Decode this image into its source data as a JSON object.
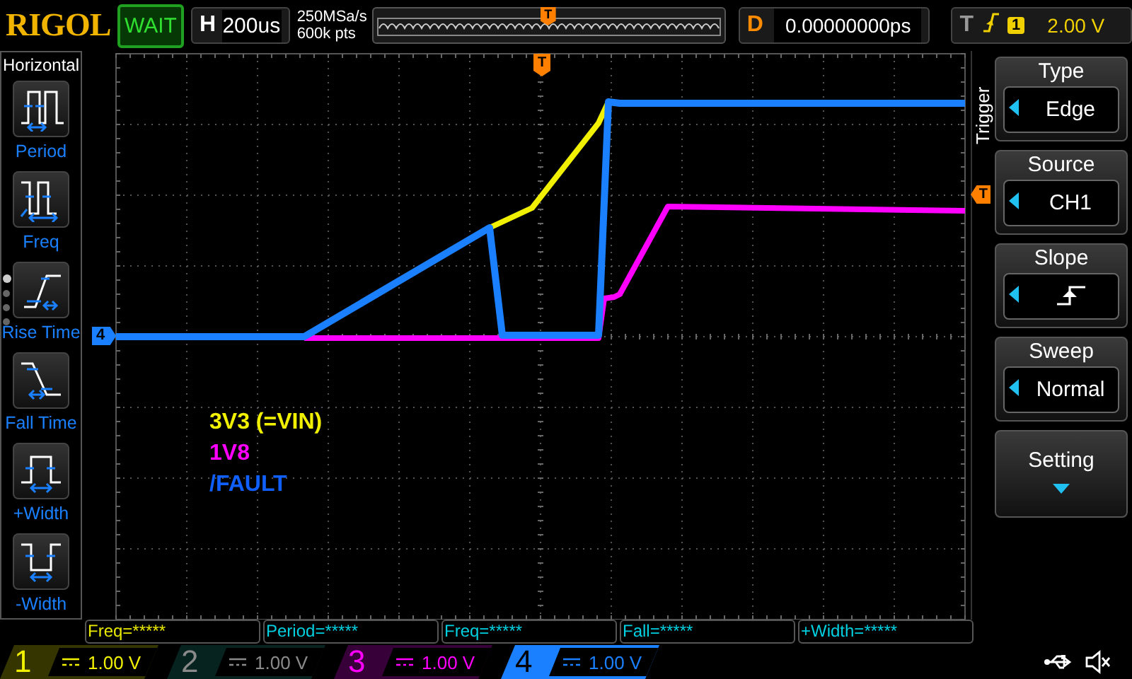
{
  "top_bar": {
    "logo": "RIGOL",
    "run_status": "WAIT",
    "horizontal": {
      "label": "H",
      "timebase": "200us"
    },
    "sample_rate": "250MSa/s",
    "memory_marker": "T",
    "memory_depth": "600k pts",
    "delay": {
      "label": "D",
      "value": "0.00000000ps"
    },
    "trigger": {
      "label": "T",
      "source": "1",
      "level": "2.00 V"
    }
  },
  "left_menu": {
    "title": "Horizontal",
    "items": [
      {
        "kind": "period",
        "label": "Period"
      },
      {
        "kind": "freq",
        "label": "Freq"
      },
      {
        "kind": "rise",
        "label": "Rise Time"
      },
      {
        "kind": "fall",
        "label": "Fall Time"
      },
      {
        "kind": "pwidth",
        "label": "+Width"
      },
      {
        "kind": "nwidth",
        "label": "-Width"
      }
    ],
    "pages": [
      {
        "selected": true
      },
      {
        "selected": false
      },
      {
        "selected": false
      },
      {
        "selected": false
      }
    ]
  },
  "plot": {
    "trigger_marker": "T",
    "level_marker": "T",
    "ground_marker": "4",
    "legend": [
      {
        "text": "3V3 (=VIN)",
        "color": "#f0f000"
      },
      {
        "text": "1V8",
        "color": "#ff00ff"
      },
      {
        "text": "/FAULT",
        "color": "#1060ff"
      }
    ]
  },
  "right_menu": {
    "title": "Trigger",
    "items": [
      {
        "kind": "value",
        "title": "Type",
        "value": "Edge"
      },
      {
        "kind": "value",
        "title": "Source",
        "value": "CH1"
      },
      {
        "kind": "rising_edge",
        "title": "Slope"
      },
      {
        "kind": "value",
        "title": "Sweep",
        "value": "Normal"
      },
      {
        "kind": "submenu",
        "title": "Setting"
      }
    ]
  },
  "measurements": [
    {
      "text": "Freq=*****",
      "color": "#e8e800"
    },
    {
      "text": "Period=*****",
      "color": "#00d0e0"
    },
    {
      "text": "Freq=*****",
      "color": "#00d0e0"
    },
    {
      "text": "Fall=*****",
      "color": "#00d0e0"
    },
    {
      "text": "+Width=*****",
      "color": "#00d0e0"
    }
  ],
  "channels": [
    {
      "number": "1",
      "scale": "1.00 V",
      "enabled": true,
      "selected": false,
      "color": "#f0f000"
    },
    {
      "number": "2",
      "scale": "1.00 V",
      "enabled": false,
      "selected": false
    },
    {
      "number": "3",
      "scale": "1.00 V",
      "enabled": true,
      "selected": false,
      "color": "#ff00ff"
    },
    {
      "number": "4",
      "scale": "1.00 V",
      "enabled": true,
      "selected": true,
      "color": "#1a80ff"
    }
  ]
}
